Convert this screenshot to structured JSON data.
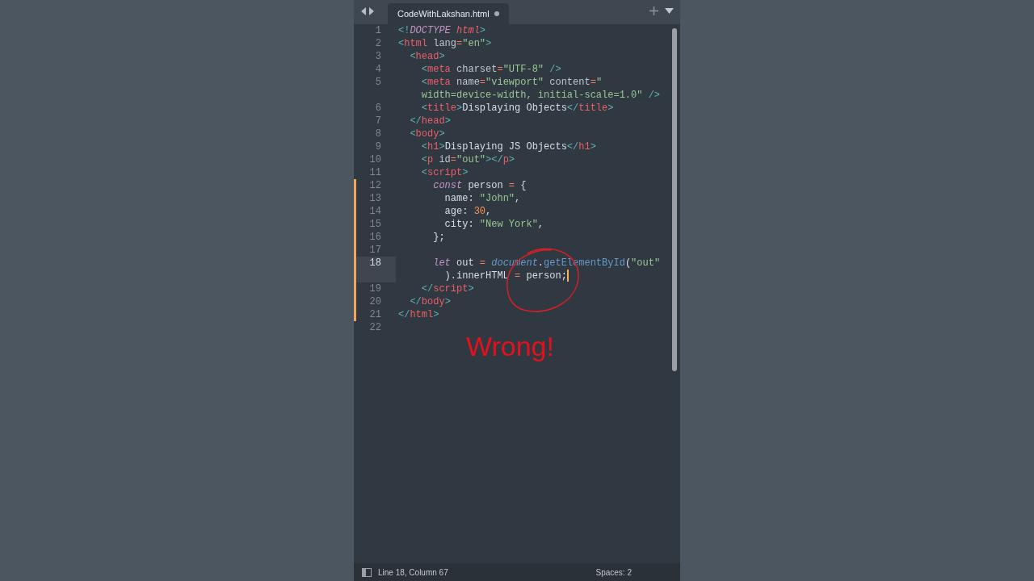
{
  "tab": {
    "title": "CodeWithLakshan.html",
    "unsaved": true
  },
  "lines": [
    {
      "number": "1",
      "modified": false,
      "current": false,
      "rows": [
        {
          "caret": false,
          "segments": [
            {
              "kind": "punct",
              "text": "<!"
            },
            {
              "kind": "keyword",
              "text": "DOCTYPE"
            },
            {
              "kind": "tag-italic",
              "text": " html"
            },
            {
              "kind": "punct",
              "text": ">"
            }
          ]
        }
      ]
    },
    {
      "number": "2",
      "modified": false,
      "current": false,
      "rows": [
        {
          "caret": false,
          "segments": [
            {
              "kind": "punct",
              "text": "<"
            },
            {
              "kind": "tag",
              "text": "html"
            },
            {
              "kind": "attr",
              "text": " lang"
            },
            {
              "kind": "op",
              "text": "="
            },
            {
              "kind": "string",
              "text": "\"en\""
            },
            {
              "kind": "punct",
              "text": ">"
            }
          ]
        }
      ]
    },
    {
      "number": "3",
      "modified": false,
      "current": false,
      "rows": [
        {
          "caret": false,
          "segments": [
            {
              "kind": "punct",
              "text": "  <"
            },
            {
              "kind": "tag",
              "text": "head"
            },
            {
              "kind": "punct",
              "text": ">"
            }
          ]
        }
      ]
    },
    {
      "number": "4",
      "modified": false,
      "current": false,
      "rows": [
        {
          "caret": false,
          "segments": [
            {
              "kind": "punct",
              "text": "    <"
            },
            {
              "kind": "tag",
              "text": "meta"
            },
            {
              "kind": "attr",
              "text": " charset"
            },
            {
              "kind": "op",
              "text": "="
            },
            {
              "kind": "string",
              "text": "\"UTF-8\""
            },
            {
              "kind": "punct",
              "text": " />"
            }
          ]
        }
      ]
    },
    {
      "number": "5",
      "modified": false,
      "current": false,
      "rows": [
        {
          "caret": false,
          "segments": [
            {
              "kind": "punct",
              "text": "    <"
            },
            {
              "kind": "tag",
              "text": "meta"
            },
            {
              "kind": "attr",
              "text": " name"
            },
            {
              "kind": "op",
              "text": "="
            },
            {
              "kind": "string",
              "text": "\"viewport\""
            },
            {
              "kind": "attr",
              "text": " content"
            },
            {
              "kind": "op",
              "text": "="
            },
            {
              "kind": "string",
              "text": "\""
            }
          ]
        },
        {
          "caret": false,
          "segments": [
            {
              "kind": "string",
              "text": "    width=device-width, initial-scale=1.0\""
            },
            {
              "kind": "punct",
              "text": " />"
            }
          ]
        }
      ]
    },
    {
      "number": "6",
      "modified": false,
      "current": false,
      "rows": [
        {
          "caret": false,
          "segments": [
            {
              "kind": "punct",
              "text": "    <"
            },
            {
              "kind": "tag",
              "text": "title"
            },
            {
              "kind": "punct",
              "text": ">"
            },
            {
              "kind": "plain",
              "text": "Displaying Objects"
            },
            {
              "kind": "punct",
              "text": "</"
            },
            {
              "kind": "tag",
              "text": "title"
            },
            {
              "kind": "punct",
              "text": ">"
            }
          ]
        }
      ]
    },
    {
      "number": "7",
      "modified": false,
      "current": false,
      "rows": [
        {
          "caret": false,
          "segments": [
            {
              "kind": "punct",
              "text": "  </"
            },
            {
              "kind": "tag",
              "text": "head"
            },
            {
              "kind": "punct",
              "text": ">"
            }
          ]
        }
      ]
    },
    {
      "number": "8",
      "modified": false,
      "current": false,
      "rows": [
        {
          "caret": false,
          "segments": [
            {
              "kind": "punct",
              "text": "  <"
            },
            {
              "kind": "tag",
              "text": "body"
            },
            {
              "kind": "punct",
              "text": ">"
            }
          ]
        }
      ]
    },
    {
      "number": "9",
      "modified": false,
      "current": false,
      "rows": [
        {
          "caret": false,
          "segments": [
            {
              "kind": "punct",
              "text": "    <"
            },
            {
              "kind": "tag",
              "text": "h1"
            },
            {
              "kind": "punct",
              "text": ">"
            },
            {
              "kind": "plain",
              "text": "Displaying JS Objects"
            },
            {
              "kind": "punct",
              "text": "</"
            },
            {
              "kind": "tag",
              "text": "h1"
            },
            {
              "kind": "punct",
              "text": ">"
            }
          ]
        }
      ]
    },
    {
      "number": "10",
      "modified": false,
      "current": false,
      "rows": [
        {
          "caret": false,
          "segments": [
            {
              "kind": "punct",
              "text": "    <"
            },
            {
              "kind": "tag",
              "text": "p"
            },
            {
              "kind": "attr",
              "text": " id"
            },
            {
              "kind": "op",
              "text": "="
            },
            {
              "kind": "string",
              "text": "\"out\""
            },
            {
              "kind": "punct",
              "text": "></"
            },
            {
              "kind": "tag",
              "text": "p"
            },
            {
              "kind": "punct",
              "text": ">"
            }
          ]
        }
      ]
    },
    {
      "number": "11",
      "modified": false,
      "current": false,
      "rows": [
        {
          "caret": false,
          "segments": [
            {
              "kind": "punct",
              "text": "    <"
            },
            {
              "kind": "tag",
              "text": "script"
            },
            {
              "kind": "punct",
              "text": ">"
            }
          ]
        }
      ]
    },
    {
      "number": "12",
      "modified": true,
      "current": false,
      "rows": [
        {
          "caret": false,
          "segments": [
            {
              "kind": "keyword",
              "text": "      const"
            },
            {
              "kind": "plain",
              "text": " person "
            },
            {
              "kind": "op",
              "text": "="
            },
            {
              "kind": "plain",
              "text": " {"
            }
          ]
        }
      ]
    },
    {
      "number": "13",
      "modified": true,
      "current": false,
      "rows": [
        {
          "caret": false,
          "segments": [
            {
              "kind": "plain",
              "text": "        name: "
            },
            {
              "kind": "string",
              "text": "\"John\""
            },
            {
              "kind": "plain",
              "text": ","
            }
          ]
        }
      ]
    },
    {
      "number": "14",
      "modified": true,
      "current": false,
      "rows": [
        {
          "caret": false,
          "segments": [
            {
              "kind": "plain",
              "text": "        age: "
            },
            {
              "kind": "number",
              "text": "30"
            },
            {
              "kind": "plain",
              "text": ","
            }
          ]
        }
      ]
    },
    {
      "number": "15",
      "modified": true,
      "current": false,
      "rows": [
        {
          "caret": false,
          "segments": [
            {
              "kind": "plain",
              "text": "        city: "
            },
            {
              "kind": "string",
              "text": "\"New York\""
            },
            {
              "kind": "plain",
              "text": ","
            }
          ]
        }
      ]
    },
    {
      "number": "16",
      "modified": true,
      "current": false,
      "rows": [
        {
          "caret": false,
          "segments": [
            {
              "kind": "plain",
              "text": "      };"
            }
          ]
        }
      ]
    },
    {
      "number": "17",
      "modified": true,
      "current": false,
      "rows": [
        {
          "caret": false,
          "segments": []
        }
      ]
    },
    {
      "number": "18",
      "modified": true,
      "current": true,
      "rows": [
        {
          "caret": false,
          "segments": [
            {
              "kind": "keyword",
              "text": "      let"
            },
            {
              "kind": "plain",
              "text": " out "
            },
            {
              "kind": "op",
              "text": "="
            },
            {
              "kind": "builtin",
              "text": " document"
            },
            {
              "kind": "plain",
              "text": "."
            },
            {
              "kind": "func",
              "text": "getElementById"
            },
            {
              "kind": "plain",
              "text": "("
            },
            {
              "kind": "string",
              "text": "\"out\""
            }
          ]
        },
        {
          "caret": true,
          "segments": [
            {
              "kind": "plain",
              "text": "        ).innerHTML "
            },
            {
              "kind": "op",
              "text": "="
            },
            {
              "kind": "plain",
              "text": " person;"
            }
          ]
        }
      ]
    },
    {
      "number": "19",
      "modified": true,
      "current": false,
      "rows": [
        {
          "caret": false,
          "segments": [
            {
              "kind": "punct",
              "text": "    </"
            },
            {
              "kind": "tag",
              "text": "script"
            },
            {
              "kind": "punct",
              "text": ">"
            }
          ]
        }
      ]
    },
    {
      "number": "20",
      "modified": true,
      "current": false,
      "rows": [
        {
          "caret": false,
          "segments": [
            {
              "kind": "punct",
              "text": "  </"
            },
            {
              "kind": "tag",
              "text": "body"
            },
            {
              "kind": "punct",
              "text": ">"
            }
          ]
        }
      ]
    },
    {
      "number": "21",
      "modified": true,
      "current": false,
      "rows": [
        {
          "caret": false,
          "segments": [
            {
              "kind": "punct",
              "text": "</"
            },
            {
              "kind": "tag",
              "text": "html"
            },
            {
              "kind": "punct",
              "text": ">"
            }
          ]
        }
      ]
    },
    {
      "number": "22",
      "modified": false,
      "current": false,
      "rows": [
        {
          "caret": false,
          "segments": []
        }
      ]
    }
  ],
  "annotation": {
    "text": "Wrong!"
  },
  "status_bar": {
    "position": "Line 18, Column 67",
    "indentation": "Spaces: 2"
  }
}
